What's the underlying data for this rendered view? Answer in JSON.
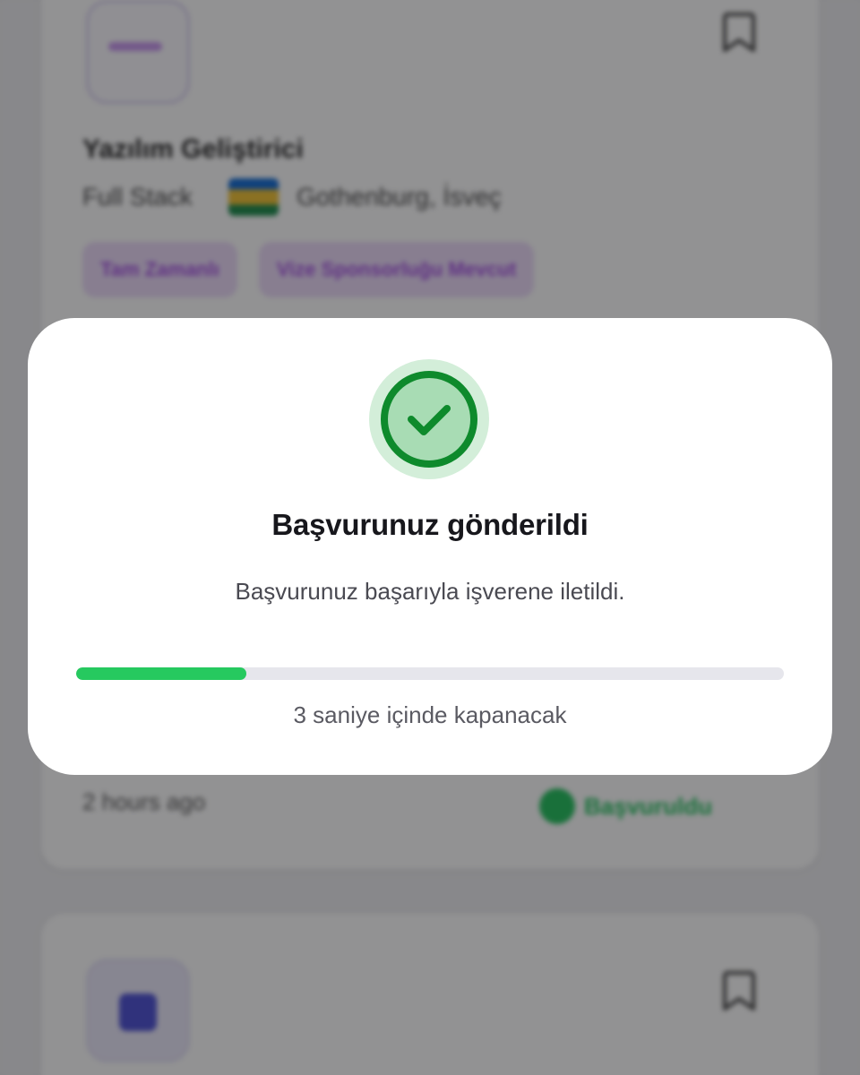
{
  "background": {
    "job_card": {
      "title": "Yazılım Geliştirici",
      "employment_type": "Full Stack",
      "location": "Gothenburg, İsveç",
      "tags": [
        "Tam Zamanlı",
        "Vize Sponsorluğu Mevcut"
      ],
      "posted_time": "2 hours ago",
      "status": "Başvuruldu"
    },
    "colors": {
      "tag_bg": "#ecdbfa",
      "tag_text": "#a34de2",
      "status_green": "#21c15c"
    }
  },
  "modal": {
    "icon": "check-circle-icon",
    "title": "Başvurunuz gönderildi",
    "message": "Başvurunuz başarıyla işverene iletildi.",
    "progress": 0.24,
    "countdown_text": "3 saniye içinde kapanacak",
    "colors": {
      "success_green": "#26c95f",
      "icon_ring": "#0e8a2c",
      "icon_fill": "#a8dcb4",
      "icon_halo": "#d3eed9",
      "track": "#e6e6ec"
    }
  }
}
